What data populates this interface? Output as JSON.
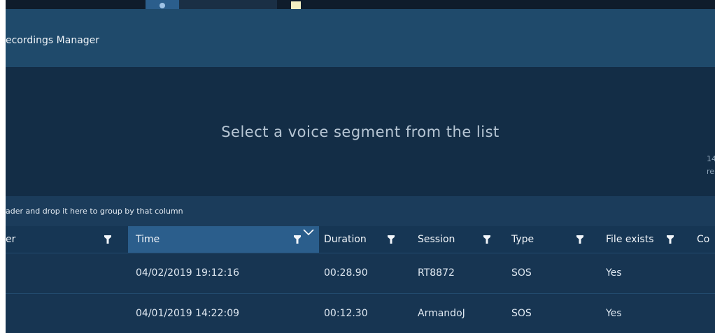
{
  "window": {
    "title": "ecordings Manager"
  },
  "player": {
    "prompt": "Select a voice segment from the list",
    "right_text_1": "14",
    "right_text_2": "re"
  },
  "grid": {
    "group_hint": "ader and drop it here to group by that column",
    "columns": [
      {
        "id": "user",
        "label": "er"
      },
      {
        "id": "time",
        "label": "Time"
      },
      {
        "id": "duration",
        "label": "Duration"
      },
      {
        "id": "session",
        "label": "Session"
      },
      {
        "id": "type",
        "label": "Type"
      },
      {
        "id": "file",
        "label": "File exists"
      },
      {
        "id": "comment",
        "label": "Co"
      }
    ],
    "sorted_column": "Time",
    "rows": [
      {
        "time": "04/02/2019 19:12:16",
        "duration": "00:28.90",
        "session": "RT8872",
        "type": "SOS",
        "file_exists": "Yes"
      },
      {
        "time": "04/01/2019 14:22:09",
        "duration": "00:12.30",
        "session": "ArmandoJ",
        "type": "SOS",
        "file_exists": "Yes"
      }
    ]
  },
  "colors": {
    "background": "#173552",
    "header_bg": "#163654",
    "active_header": "#2b5e8c",
    "titlebar": "#1f4a6b"
  }
}
